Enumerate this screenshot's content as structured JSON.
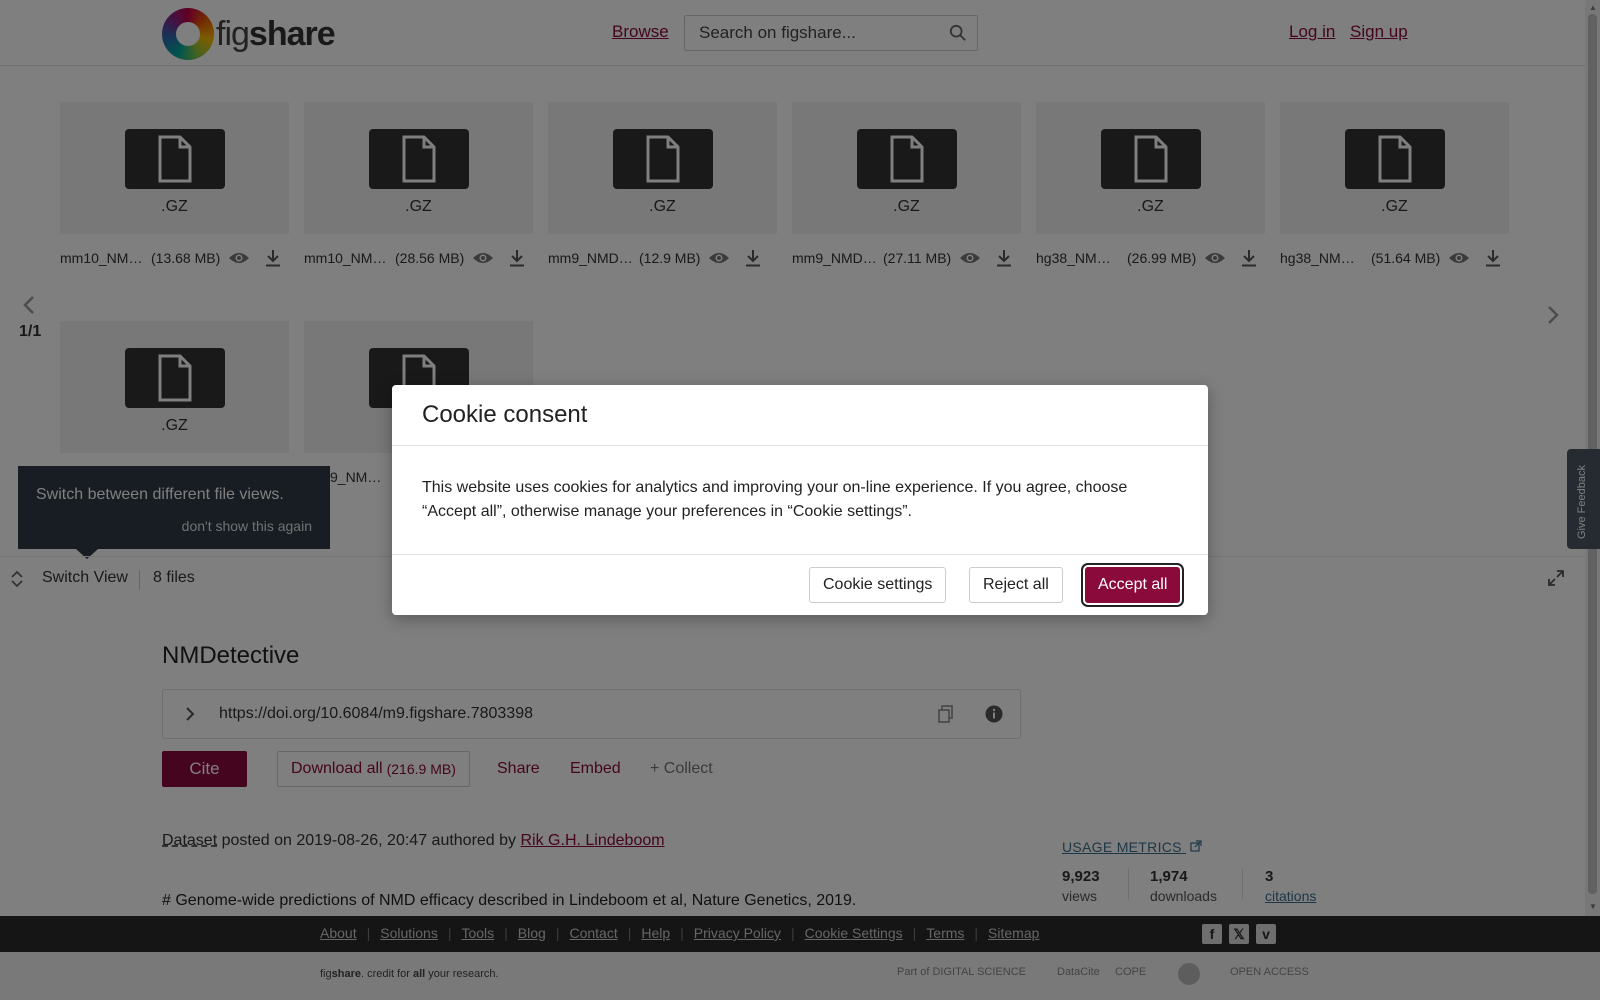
{
  "header": {
    "logo_plain": "fig",
    "logo_bold": "share",
    "browse": "Browse",
    "search_placeholder": "Search on figshare...",
    "login": "Log in",
    "signup": "Sign up"
  },
  "viewer": {
    "files": [
      {
        "ext": ".GZ",
        "name": "mm10_NM…",
        "size": "(13.68 MB)"
      },
      {
        "ext": ".GZ",
        "name": "mm10_NM…",
        "size": "(28.56 MB)"
      },
      {
        "ext": ".GZ",
        "name": "mm9_NMD…",
        "size": "(12.9 MB)"
      },
      {
        "ext": ".GZ",
        "name": "mm9_NMD…",
        "size": "(27.11 MB)"
      },
      {
        "ext": ".GZ",
        "name": "hg38_NM…",
        "size": "(26.99 MB)"
      },
      {
        "ext": ".GZ",
        "name": "hg38_NM…",
        "size": "(51.64 MB)"
      },
      {
        "ext": ".GZ",
        "name": "",
        "size": ""
      },
      {
        "ext": "",
        "name": "9_NM…",
        "size": ""
      }
    ],
    "pager": "1/1",
    "tooltip_text": "Switch between different file views.",
    "tooltip_dismiss": "don't show this again",
    "switch_view": "Switch View",
    "files_count": "8 files"
  },
  "main": {
    "title": "NMDetective",
    "doi": "https://doi.org/10.6084/m9.figshare.7803398",
    "cite": "Cite",
    "download_all": "Download all",
    "download_all_size": "(216.9 MB)",
    "share": "Share",
    "embed": "Embed",
    "collect": "+ Collect",
    "item_type": "Dataset",
    "posted_text": "posted on 2019-08-26, 20:47 authored by",
    "author": "Rik G.H. Lindeboom",
    "description": "# Genome-wide predictions of NMD efficacy described in Lindeboom et al, Nature Genetics, 2019.",
    "usage_metrics": "USAGE METRICS",
    "metrics": [
      {
        "value": "9,923",
        "label": "views"
      },
      {
        "value": "1,974",
        "label": "downloads"
      },
      {
        "value": "3",
        "label": "citations"
      }
    ]
  },
  "feedback": "Give Feedback",
  "footer": {
    "links": [
      "About",
      "Solutions",
      "Tools",
      "Blog",
      "Contact",
      "Help",
      "Privacy Policy",
      "Cookie Settings",
      "Terms",
      "Sitemap"
    ],
    "tagline_a": "fig",
    "tagline_b": "share",
    "tagline_c": ". credit for ",
    "tagline_d": "all",
    "tagline_e": " your research.",
    "partners": [
      "Part of DIGITAL SCIENCE",
      "DataCite",
      "COPE",
      "OPEN ACCESS"
    ]
  },
  "modal": {
    "title": "Cookie consent",
    "body": "This website uses cookies for analytics and improving your on-line experience. If you agree, choose “Accept all”, otherwise manage your preferences in “Cookie settings”.",
    "settings": "Cookie settings",
    "reject": "Reject all",
    "accept": "Accept all"
  },
  "colors": {
    "brand": "#8a0a3c",
    "footer_dark": "#2b2b2b",
    "tooltip_bg": "#2f3b45",
    "metric_link": "#3b6f8f"
  },
  "icons": [
    "search-icon",
    "file-icon",
    "eye-icon",
    "download-icon",
    "chevron-left-icon",
    "chevron-right-icon",
    "switch-view-icon",
    "expand-icon",
    "chevron-right-icon",
    "copy-icon",
    "info-icon",
    "external-link-icon",
    "facebook-icon",
    "x-icon",
    "vimeo-icon"
  ]
}
